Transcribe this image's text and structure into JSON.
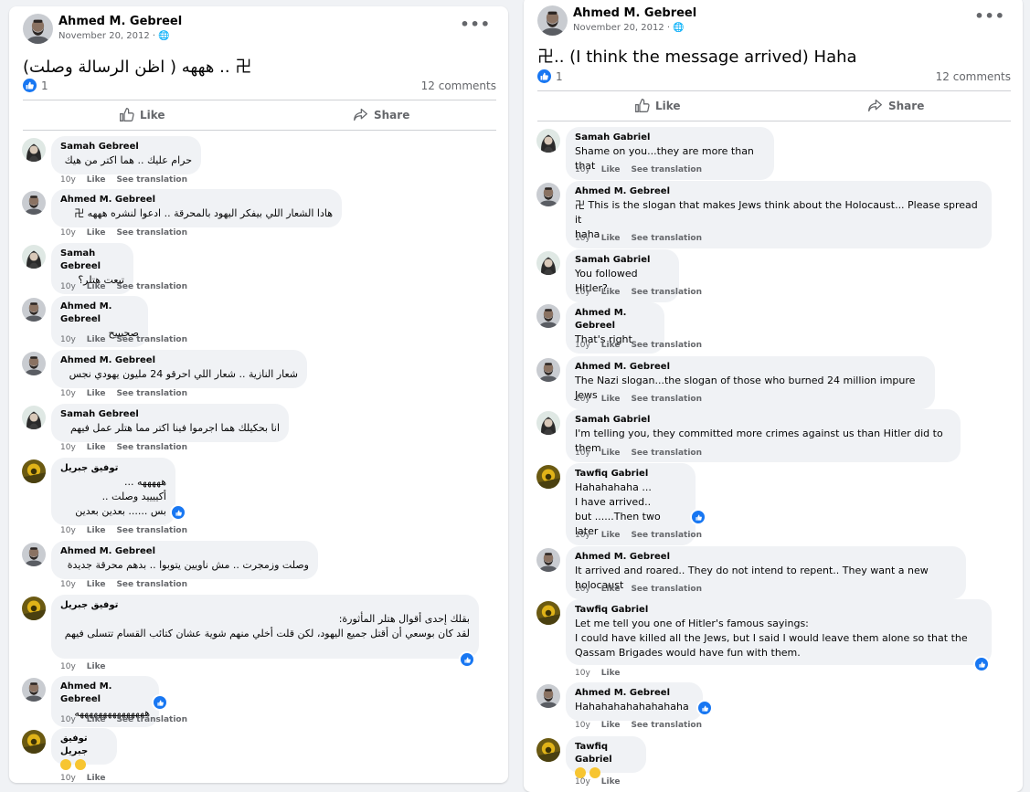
{
  "left": {
    "author": "Ahmed M. Gebreel",
    "date": "November 20, 2012 · ",
    "text": "هههه ( اظن الرسالة وصلت) .. 卍",
    "likes": "1",
    "comments_count": "12 comments",
    "like_label": "Like",
    "share_label": "Share",
    "comments": [
      {
        "name": "Samah Gebreel",
        "text": "حرام عليك .. هما اكتر من هيك",
        "time": "10y",
        "like": "Like",
        "translate": "See translation"
      },
      {
        "name": "Ahmed M. Gebreel",
        "text": "هادا الشعار اللي بيفكر اليهود بالمحرقة .. ادعوا لنشره هههه 卍",
        "time": "10y",
        "like": "Like",
        "translate": "See translation"
      },
      {
        "name": "Samah Gebreel",
        "text": "تبعت هتلر؟",
        "time": "10y",
        "like": "Like",
        "translate": "See translation"
      },
      {
        "name": "Ahmed M. Gebreel",
        "text": "صحيييح",
        "time": "10y",
        "like": "Like",
        "translate": "See translation"
      },
      {
        "name": "Ahmed M. Gebreel",
        "text": "شعار النازية .. شعار اللي احرقو 24 مليون يهودي نجس",
        "time": "10y",
        "like": "Like",
        "translate": "See translation"
      },
      {
        "name": "Samah Gebreel",
        "text": "انا بحكيلك هما اجرموا فينا اكتر مما هتلر عمل فيهم",
        "time": "10y",
        "like": "Like",
        "translate": "See translation"
      },
      {
        "name": "توفيق جبريل",
        "text": "هههههه ...\nأكييييد وصلت ..\nبس ...... بعدين بعدين",
        "time": "10y",
        "like": "Like",
        "translate": "See translation"
      },
      {
        "name": "Ahmed M. Gebreel",
        "text": "وصلت وزمجرت .. مش ناويين يتوبوا .. بدهم محرقة جديدة",
        "time": "10y",
        "like": "Like",
        "translate": "See translation"
      },
      {
        "name": "توفيق جبريل",
        "text": "بقلك إحدى أقوال هتلر المأثورة:\nلقد كان بوسعي أن أقتل جميع اليهود، لكن قلت أخلي منهم شوية عشان كتائب القسام تتسلى فيهم",
        "time": "10y",
        "like": "Like",
        "translate": ""
      },
      {
        "name": "Ahmed M. Gebreel",
        "text": "هههههههههههههههه",
        "time": "10y",
        "like": "Like",
        "translate": "See translation"
      },
      {
        "name": "توفيق جبريل",
        "text": "",
        "time": "10y",
        "like": "Like",
        "translate": ""
      }
    ]
  },
  "right": {
    "author": "Ahmed M. Gebreel",
    "date": "November 20, 2012 · ",
    "text": "卍.. (I think the message arrived) Haha",
    "likes": "1",
    "comments_count": "12 comments",
    "like_label": "Like",
    "share_label": "Share",
    "comments": [
      {
        "name": "Samah Gabriel",
        "text": "Shame on you...they are more than that",
        "time": "10y",
        "like": "Like",
        "translate": "See translation"
      },
      {
        "name": "Ahmed M. Gebreel",
        "text": "卍 This is the slogan that makes Jews think about the Holocaust... Please spread it\nhaha",
        "time": "10y",
        "like": "Like",
        "translate": "See translation"
      },
      {
        "name": "Samah Gabriel",
        "text": "You followed Hitler?",
        "time": "10y",
        "like": "Like",
        "translate": "See translation"
      },
      {
        "name": "Ahmed M. Gebreel",
        "text": "That's right",
        "time": "10y",
        "like": "Like",
        "translate": "See translation"
      },
      {
        "name": "Ahmed M. Gebreel",
        "text": "The Nazi slogan...the slogan of those who burned 24 million impure Jews",
        "time": "10y",
        "like": "Like",
        "translate": "See translation"
      },
      {
        "name": "Samah Gabriel",
        "text": "I'm telling you, they committed more crimes against us than Hitler did to them",
        "time": "10y",
        "like": "Like",
        "translate": "See translation"
      },
      {
        "name": "Tawfiq Gabriel",
        "text": "Hahahahaha ...\nI have arrived..\nbut ......Then two later",
        "time": "10y",
        "like": "Like",
        "translate": "See translation"
      },
      {
        "name": "Ahmed M. Gebreel",
        "text": "It arrived and roared.. They do not intend to repent.. They want a new holocaust",
        "time": "10y",
        "like": "Like",
        "translate": "See translation"
      },
      {
        "name": "Tawfiq Gabriel",
        "text": "Let me tell you one of Hitler's famous sayings:\nI could have killed all the Jews, but I said I would leave them alone so that the\nQassam Brigades would have fun with them.",
        "time": "10y",
        "like": "Like",
        "translate": ""
      },
      {
        "name": "Ahmed M. Gebreel",
        "text": "Hahahahahahahahaha",
        "time": "10y",
        "like": "Like",
        "translate": "See translation"
      },
      {
        "name": "Tawfiq Gabriel",
        "text": "",
        "time": "10y",
        "like": "Like",
        "translate": ""
      }
    ]
  },
  "icons": {
    "more": "more-options-icon",
    "globe": "globe-icon",
    "like": "thumbs-up-icon",
    "share": "share-icon"
  },
  "colors": {
    "accent": "#1877f2",
    "bubble": "#f0f2f5",
    "secondary_text": "#65676b"
  }
}
